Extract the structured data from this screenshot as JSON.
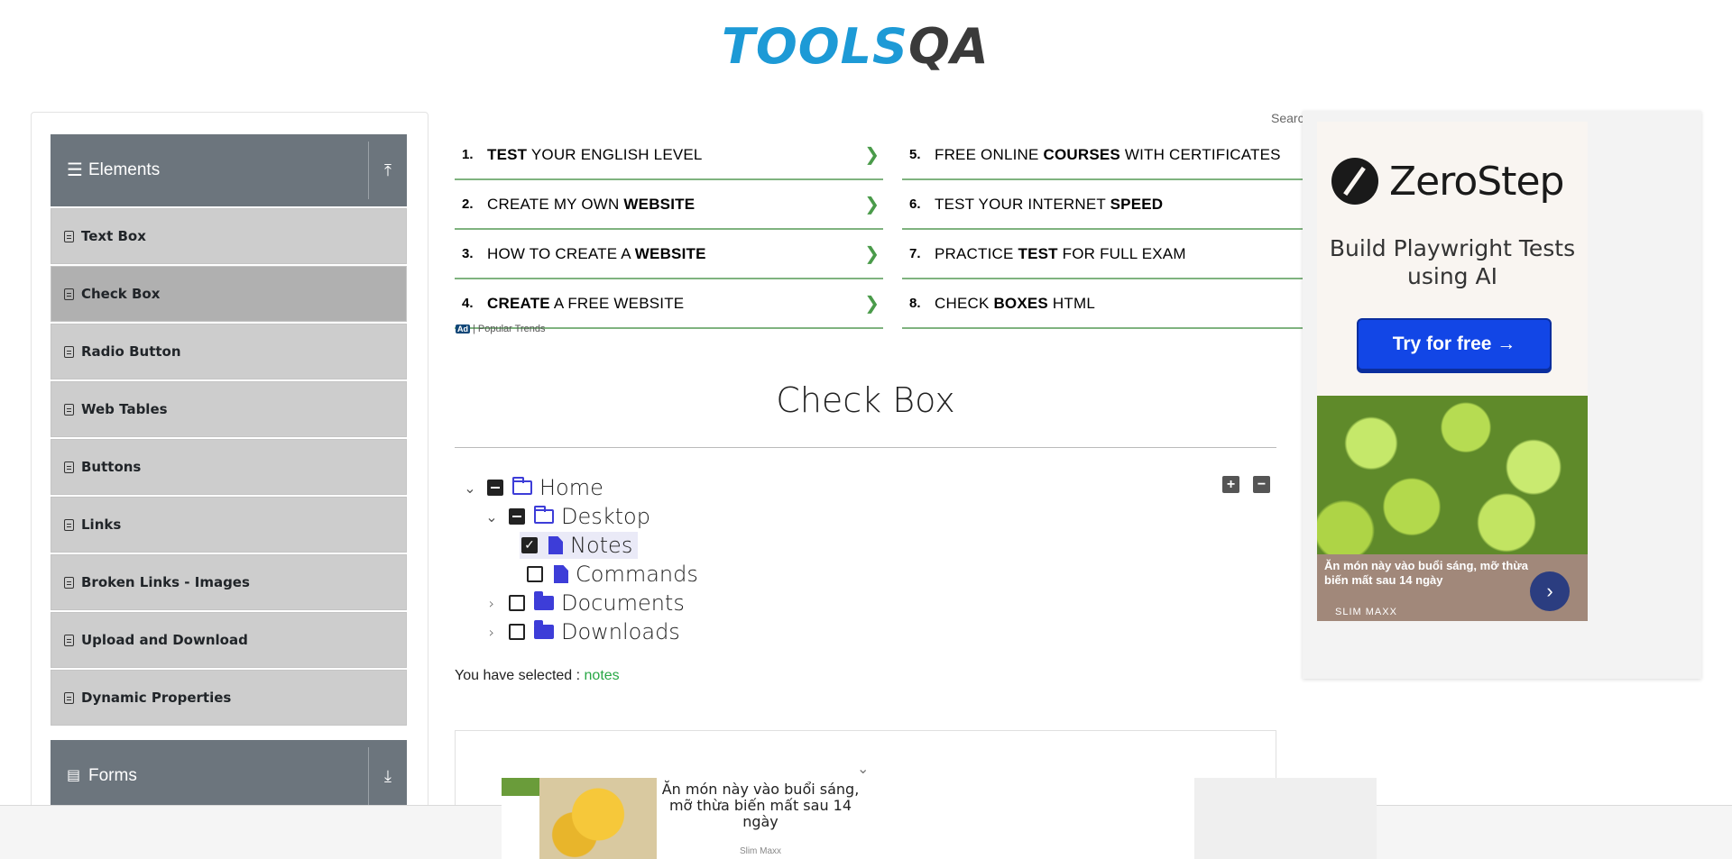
{
  "logo": {
    "part1": "TOOLS",
    "part2": "QA"
  },
  "sidebar": {
    "elements_header": {
      "label": "Elements",
      "icon": "hamburger-icon",
      "toggle_icon": "upload-icon"
    },
    "items": [
      {
        "label": "Text Box"
      },
      {
        "label": "Check Box",
        "active": true
      },
      {
        "label": "Radio Button"
      },
      {
        "label": "Web Tables"
      },
      {
        "label": "Buttons"
      },
      {
        "label": "Links"
      },
      {
        "label": "Broken Links - Images"
      },
      {
        "label": "Upload and Download"
      },
      {
        "label": "Dynamic Properties"
      }
    ],
    "forms_header": {
      "label": "Forms",
      "icon": "document-icon",
      "toggle_icon": "download-icon"
    }
  },
  "trends": {
    "left": [
      {
        "num": "1.",
        "pre": "",
        "bold": "TEST",
        "post": " YOUR ENGLISH LEVEL"
      },
      {
        "num": "2.",
        "pre": "CREATE MY OWN ",
        "bold": "WEBSITE",
        "post": ""
      },
      {
        "num": "3.",
        "pre": "HOW TO CREATE A ",
        "bold": "WEBSITE",
        "post": ""
      },
      {
        "num": "4.",
        "pre": "",
        "bold": "CREATE",
        "post": " A FREE WEBSITE"
      }
    ],
    "right": [
      {
        "num": "5.",
        "pre": "FREE ONLINE ",
        "bold": "COURSES",
        "post": " WITH CERTIFICATES"
      },
      {
        "num": "6.",
        "pre": "TEST YOUR INTERNET ",
        "bold": "SPEED",
        "post": ""
      },
      {
        "num": "7.",
        "pre": "PRACTICE ",
        "bold": "TEST",
        "post": " FOR FULL EXAM"
      },
      {
        "num": "8.",
        "pre": "CHECK ",
        "bold": "BOXES",
        "post": " HTML"
      }
    ],
    "ad_badge": "Ad",
    "ad_label": "| Popular Trends",
    "search_snip": "Search"
  },
  "page": {
    "title": "Check Box"
  },
  "tree": {
    "home": "Home",
    "desktop": "Desktop",
    "notes": "Notes",
    "commands": "Commands",
    "documents": "Documents",
    "downloads": "Downloads",
    "expand_all": "+",
    "collapse_all": "−"
  },
  "result": {
    "prefix": "You have selected :",
    "value": "notes"
  },
  "right_ad": {
    "brand": "ZeroStep",
    "subtitle": "Build Playwright Tests using AI",
    "cta": "Try for free →",
    "food_caption": "Ăn món này vào buổi sáng, mỡ thừa biến mất sau 14 ngày",
    "food_brand": "SLIM MAXX"
  },
  "bottom_ad": {
    "text": "Ăn món này vào buổi sáng, mỡ thừa biến mất sau 14 ngày",
    "brand": "Slim Maxx"
  },
  "colors": {
    "accent": "#1d9ad6",
    "sidebar_header": "#6c757d",
    "folder": "#3d3dd8",
    "success": "#28a745",
    "cta": "#1246e6"
  }
}
